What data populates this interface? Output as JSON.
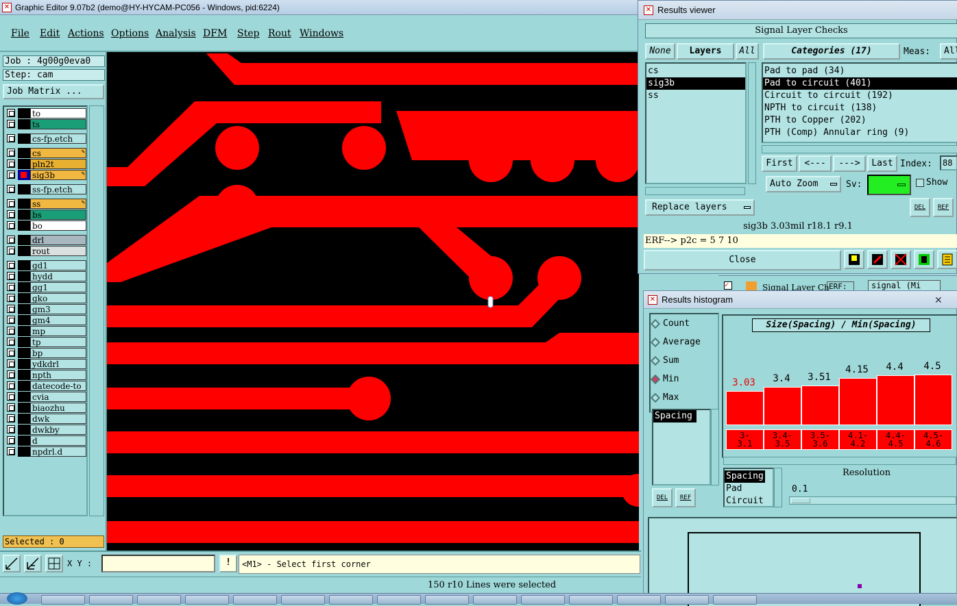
{
  "main_window": {
    "title": "Graphic Editor 9.07b2 (demo@HY-HYCAM-PC056 - Windows, pid:6224)",
    "menu": [
      "File",
      "Edit",
      "Actions",
      "Options",
      "Analysis",
      "DFM",
      "Step",
      "Rout",
      "Windows"
    ]
  },
  "left_panel": {
    "job": "Job : 4g00g0eva0",
    "step": "Step: cam",
    "job_matrix": "Job Matrix ...",
    "layers": [
      {
        "name": "to",
        "color": "#ffffff"
      },
      {
        "name": "ts",
        "color": "#1a9e78"
      },
      {
        "name": "cs-fp.etch",
        "color": "#b3e3e3"
      },
      {
        "name": "cs",
        "color": "#f0b840",
        "icon": "edit-icon"
      },
      {
        "name": "pln2t",
        "color": "#e8b030"
      },
      {
        "name": "sig3b",
        "color": "#f0b840",
        "icon": "edit-icon",
        "active": true
      },
      {
        "name": "ss-fp.etch",
        "color": "#b3e3e3"
      },
      {
        "name": "ss",
        "color": "#f0b840",
        "icon": "edit-icon"
      },
      {
        "name": "bs",
        "color": "#1a9e78"
      },
      {
        "name": "bo",
        "color": "#ffffff"
      },
      {
        "name": "drl",
        "color": "#a8b8c0"
      },
      {
        "name": "rout",
        "color": "#d8e0e0"
      },
      {
        "name": "gd1",
        "color": "#b3e3e3"
      },
      {
        "name": "hydd",
        "color": "#b3e3e3"
      },
      {
        "name": "gg1",
        "color": "#b3e3e3"
      },
      {
        "name": "gko",
        "color": "#b3e3e3"
      },
      {
        "name": "gm3",
        "color": "#b3e3e3"
      },
      {
        "name": "gm4",
        "color": "#b3e3e3"
      },
      {
        "name": "mp",
        "color": "#b3e3e3"
      },
      {
        "name": "tp",
        "color": "#b3e3e3"
      },
      {
        "name": "bp",
        "color": "#b3e3e3"
      },
      {
        "name": "ydkdrl",
        "color": "#b3e3e3"
      },
      {
        "name": "npth",
        "color": "#b3e3e3"
      },
      {
        "name": "datecode-to",
        "color": "#b3e3e3"
      },
      {
        "name": "cvia",
        "color": "#b3e3e3"
      },
      {
        "name": "biaozhu",
        "color": "#b3e3e3"
      },
      {
        "name": "dwk",
        "color": "#b3e3e3"
      },
      {
        "name": "dwkby",
        "color": "#b3e3e3"
      },
      {
        "name": "d",
        "color": "#b3e3e3"
      },
      {
        "name": "npdrl.d",
        "color": "#b3e3e3"
      }
    ],
    "selected": "Selected : 0"
  },
  "bottom": {
    "xy_label": "X Y :",
    "xy_value": "",
    "excl": "!",
    "message": "<M1> - Select first corner",
    "status": "150 r10 Lines were selected"
  },
  "results_viewer": {
    "title": "Results viewer",
    "header": "Signal Layer Checks",
    "layer_buttons": [
      "None",
      "Layers",
      "All"
    ],
    "layers": [
      "cs",
      "sig3b",
      "ss"
    ],
    "selected_layer": "sig3b",
    "categories_label": "Categories (17)",
    "meas_label": "Meas:",
    "meas_value": "All",
    "categories": [
      "Pad to pad (34)",
      "Pad to circuit (401)",
      "Circuit to circuit (192)",
      "NPTH to circuit (138)",
      "PTH to Copper (202)",
      "PTH (Comp) Annular ring (9)"
    ],
    "selected_category": "Pad to circuit (401)",
    "nav": [
      "First",
      "<---",
      "--->",
      "Last"
    ],
    "index_label": "Index:",
    "index_value": "88",
    "auto_zoom": "Auto Zoom",
    "sv_label": "Sv:",
    "show_label": "Show",
    "del_label": "DEL",
    "ref_label": "REF",
    "replace_layers": "Replace layers",
    "info": "sig3b 3.03mil   r18.1  r9.1",
    "erf": "ERF--> p2c = 5 7 10",
    "close": "Close"
  },
  "background_window": {
    "title": "Signal Layer Ch",
    "erf": "ERF:",
    "field": "signal (Mi"
  },
  "histogram": {
    "title": "Results histogram",
    "modes": [
      "Count",
      "Average",
      "Sum",
      "Min",
      "Max"
    ],
    "selected_mode": "Min",
    "chart_title": "Size(Spacing) / Min(Spacing)",
    "list_left": [
      "Spacing"
    ],
    "list_right": [
      "Spacing",
      "Pad",
      "Circuit"
    ],
    "resolution_label": "Resolution",
    "resolution_value": "0.1",
    "del_label": "DEL",
    "ref_label": "REF"
  },
  "chart_data": {
    "type": "bar",
    "title": "Size(Spacing) / Min(Spacing)",
    "categories": [
      "3-3.1",
      "3.4-3.5",
      "3.5-3.6",
      "4.1-4.2",
      "4.4-4.5",
      "4.5-4.6"
    ],
    "category_lines": [
      [
        "3-",
        "3.1"
      ],
      [
        "3.4-",
        "3.5"
      ],
      [
        "3.5-",
        "3.6"
      ],
      [
        "4.1-",
        "4.2"
      ],
      [
        "4.4-",
        "4.5"
      ],
      [
        "4.5-",
        "4.6"
      ]
    ],
    "values": [
      3.03,
      3.4,
      3.51,
      4.15,
      4.4,
      4.5
    ],
    "value_labels": [
      "3.03",
      "3.4",
      "3.51",
      "4.15",
      "4.4",
      "4.5"
    ],
    "highlight_index": 0,
    "bar_color": "#ff0000"
  }
}
